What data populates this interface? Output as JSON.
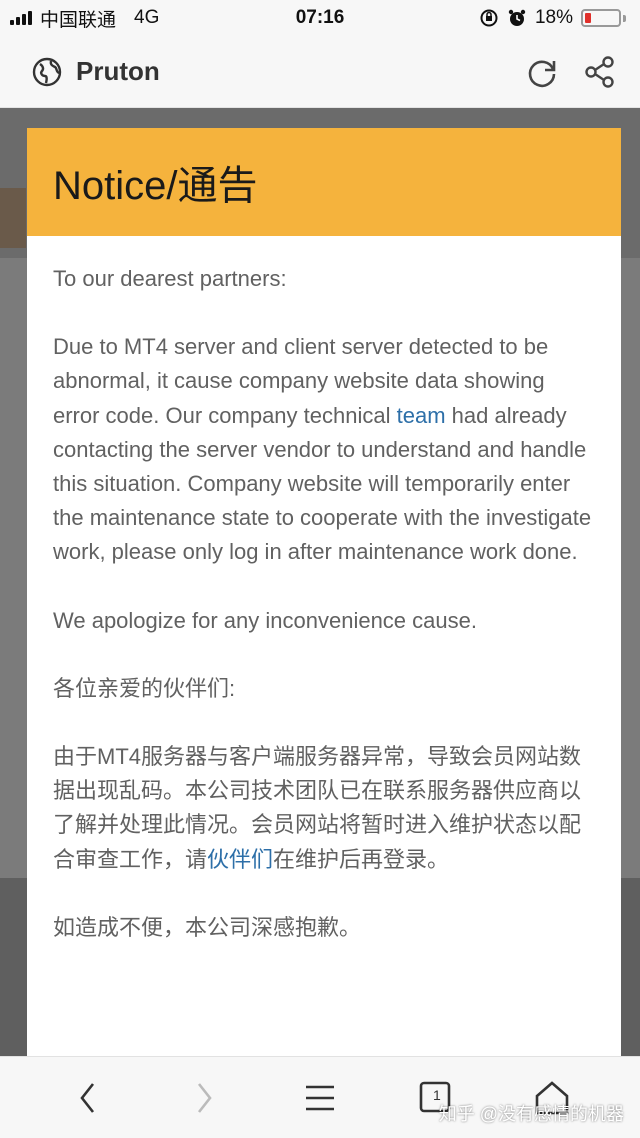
{
  "status_bar": {
    "carrier": "中国联通",
    "network": "4G",
    "time": "07:16",
    "battery": "18%"
  },
  "browser": {
    "site_title": "Pruton",
    "icons": {
      "globe": "globe-icon",
      "refresh": "refresh-icon",
      "share": "share-icon"
    }
  },
  "notice": {
    "title": "Notice/通告",
    "greeting_en": "To our dearest partners:",
    "body_en_1": "Due to MT4 server and client server detected to be abnormal, it cause company website data showing error code. Our company technical ",
    "body_en_link": "team",
    "body_en_2": " had already contacting the server vendor to understand and handle this situation. Company website will temporarily enter the maintenance state to cooperate with the investigate work, please only log in after maintenance work done.",
    "apology_en": "We apologize for any inconvenience cause.",
    "greeting_cn": "各位亲爱的伙伴们:",
    "body_cn_1": "由于MT4服务器与客户端服务器异常，导致会员网站数据出现乱码。本公司技术团队已在联系服务器供应商以了解并处理此情况。会员网站将暂时进入维护状态以配合审查工作，请",
    "body_cn_link": "伙伴们",
    "body_cn_2": "在维护后再登录。",
    "apology_cn": "如造成不便，本公司深感抱歉。"
  },
  "toolbar": {
    "tab_count": "1",
    "icons": [
      "back-icon",
      "forward-icon",
      "menu-icon",
      "tabs-icon",
      "home-icon"
    ]
  },
  "watermark": "知乎 @没有感情的机器",
  "colors": {
    "header_accent": "#f5b33d",
    "link": "#2d6fa8",
    "battery_low": "#e0302b"
  }
}
